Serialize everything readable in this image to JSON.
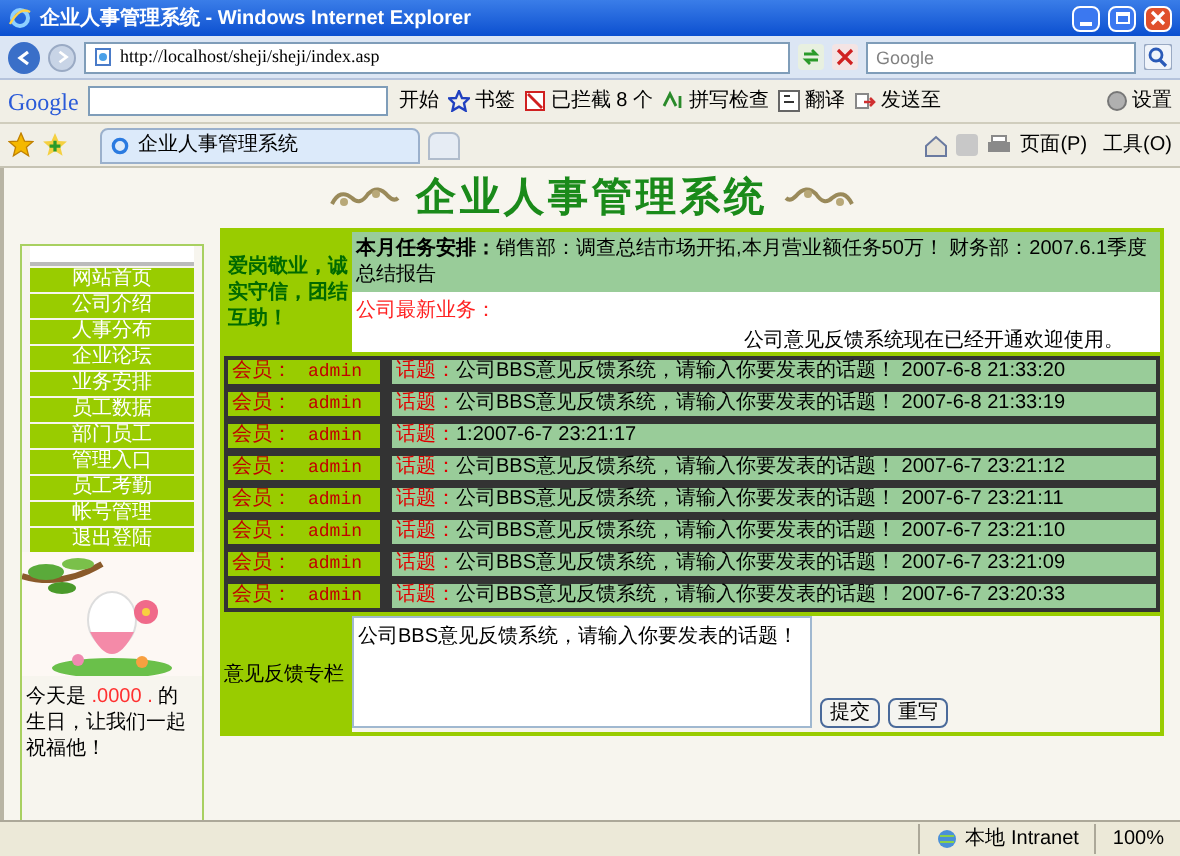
{
  "window": {
    "title": "企业人事管理系统 - Windows Internet Explorer"
  },
  "address_bar": {
    "url": "http://localhost/sheji/sheji/index.asp",
    "search_placeholder": "Google"
  },
  "google_toolbar": {
    "logo": "Google",
    "items": [
      "开始",
      "书签",
      "已拦截 8 个",
      "拼写检查",
      "翻译",
      "发送至",
      "设置"
    ]
  },
  "tab_bar": {
    "tab": "企业人事管理系统",
    "commands": [
      "页面(P)",
      "工具(O)"
    ]
  },
  "page": {
    "title": "企业人事管理系统",
    "nav": [
      {
        "label": "网站首页"
      },
      {
        "label": "公司介绍"
      },
      {
        "label": "人事分布"
      },
      {
        "label": "企业论坛"
      },
      {
        "label": "业务安排"
      },
      {
        "label": "员工数据"
      },
      {
        "label": "部门员工"
      },
      {
        "label": "管理入口"
      },
      {
        "label": "员工考勤"
      },
      {
        "label": "帐号管理"
      },
      {
        "label": "退出登陆"
      }
    ],
    "birthday": {
      "prefix": "今天是",
      "name": " .0000 . ",
      "suffix": "的生日，让我们一起祝福他！"
    },
    "motto": "爱岗敬业，诚实守信，团结互助！",
    "task": "**本月任务安排：**销售部：调查总结市场开拓,本月营业额任务50万！ 财务部：2007.6.1季度总结报告",
    "news_label": "公司最新业务：",
    "news": "公司意见反馈系统现在已经开通欢迎使用。",
    "posts": [
      {
        "member_label": "会员：",
        "member": "admin",
        "topic_label": "话题：",
        "topic": "公司BBS意见反馈系统，请输入你要发表的话题！ 2007-6-8 21:33:20"
      },
      {
        "member_label": "会员：",
        "member": "admin",
        "topic_label": "话题：",
        "topic": "公司BBS意见反馈系统，请输入你要发表的话题！ 2007-6-8 21:33:19"
      },
      {
        "member_label": "会员：",
        "member": "admin",
        "topic_label": "话题：",
        "topic": "1:2007-6-7 23:21:17"
      },
      {
        "member_label": "会员：",
        "member": "admin",
        "topic_label": "话题：",
        "topic": "公司BBS意见反馈系统，请输入你要发表的话题！ 2007-6-7 23:21:12"
      },
      {
        "member_label": "会员：",
        "member": "admin",
        "topic_label": "话题：",
        "topic": "公司BBS意见反馈系统，请输入你要发表的话题！ 2007-6-7 23:21:11"
      },
      {
        "member_label": "会员：",
        "member": "admin",
        "topic_label": "话题：",
        "topic": "公司BBS意见反馈系统，请输入你要发表的话题！ 2007-6-7 23:21:10"
      },
      {
        "member_label": "会员：",
        "member": "admin",
        "topic_label": "话题：",
        "topic": "公司BBS意见反馈系统，请输入你要发表的话题！ 2007-6-7 23:21:09"
      },
      {
        "member_label": "会员：",
        "member": "admin",
        "topic_label": "话题：",
        "topic": "公司BBS意见反馈系统，请输入你要发表的话题！ 2007-6-7 23:20:33"
      }
    ],
    "feedback": {
      "label": "意见反馈专栏",
      "value": "公司BBS意见反馈系统，请输入你要发表的话题！",
      "buttons": [
        "提交",
        "重写"
      ]
    }
  },
  "status_bar": {
    "zone": "本地 Intranet",
    "zoom": "100%"
  }
}
